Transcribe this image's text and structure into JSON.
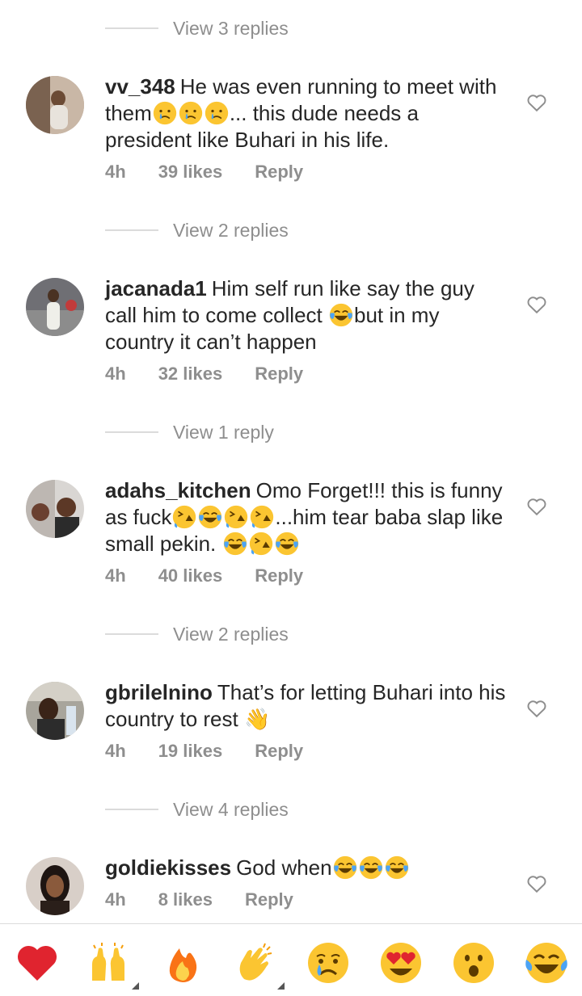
{
  "view_replies": [
    "View 3 replies",
    "View 2 replies",
    "View 1 reply",
    "View 2 replies",
    "View 4 replies"
  ],
  "comments": [
    {
      "user": "vv_348",
      "text_parts": [
        "He was even running to meet with them",
        "... this dude needs a president like Buhari in his life."
      ],
      "time": "4h",
      "likes": "39 likes",
      "reply": "Reply"
    },
    {
      "user": "jacanada1",
      "text_parts": [
        "Him self run like say the guy call him to come collect ",
        "but in my country it can’t happen"
      ],
      "time": "4h",
      "likes": "32 likes",
      "reply": "Reply"
    },
    {
      "user": "adahs_kitchen",
      "text_parts": [
        "Omo Forget!!! this is funny as fuck",
        "...him tear baba slap like small pekin. "
      ],
      "time": "4h",
      "likes": "40 likes",
      "reply": "Reply"
    },
    {
      "user": "gbrilelnino",
      "text_parts": [
        "That’s for letting Buhari into his country to rest "
      ],
      "time": "4h",
      "likes": "19 likes",
      "reply": "Reply"
    },
    {
      "user": "goldiekisses",
      "text_parts": [
        "God when"
      ],
      "time": "4h",
      "likes": "8 likes",
      "reply": "Reply"
    }
  ],
  "reaction_bar": [
    "red-heart-emoji",
    "raising-hands-emoji",
    "fire-emoji",
    "clapping-hands-emoji",
    "crying-face-emoji",
    "heart-eyes-emoji",
    "surprised-face-emoji",
    "tears-of-joy-emoji"
  ],
  "colors": {
    "text": "#262626",
    "muted": "#8e8e8e",
    "heart": "#ed4956",
    "emoji_yellow": "#fbc531"
  }
}
